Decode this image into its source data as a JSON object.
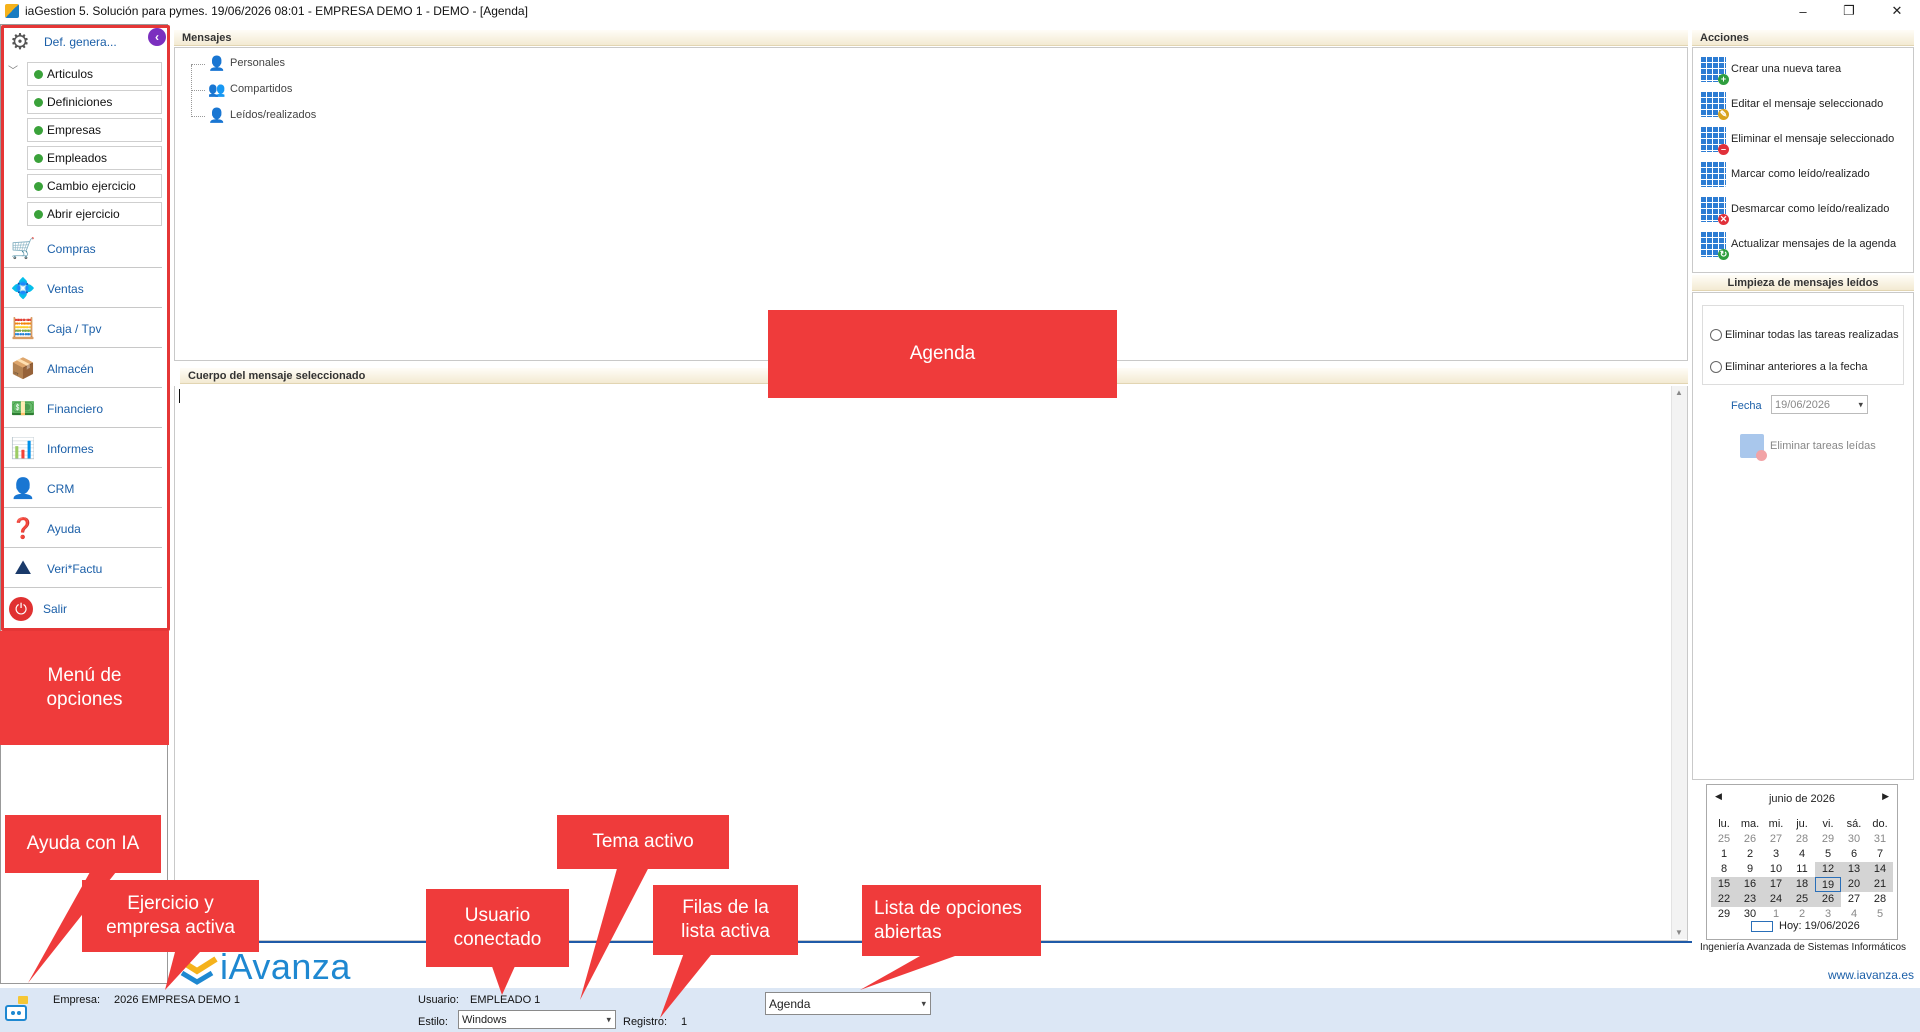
{
  "titlebar": {
    "title": "iaGestion 5. Solución para pymes.   19/06/2026 08:01   -   EMPRESA DEMO 1 - DEMO - [Agenda]",
    "minimize": "–",
    "maximize": "❐",
    "close": "✕"
  },
  "sidebar": {
    "header": "Def. genera...",
    "collapse_icon": "‹",
    "subitems": [
      "Articulos",
      "Definiciones",
      "Empresas",
      "Empleados",
      "Cambio ejercicio",
      "Abrir ejercicio"
    ],
    "items": [
      {
        "label": "Compras",
        "icon": "shopping-cart-icon",
        "glyph": "🛒"
      },
      {
        "label": "Ventas",
        "icon": "sales-icon",
        "glyph": "💠"
      },
      {
        "label": "Caja / Tpv",
        "icon": "cash-register-icon",
        "glyph": "🧮"
      },
      {
        "label": "Almacén",
        "icon": "warehouse-icon",
        "glyph": "📦"
      },
      {
        "label": "Financiero",
        "icon": "finance-icon",
        "glyph": "💵"
      },
      {
        "label": "Informes",
        "icon": "reports-icon",
        "glyph": "📊"
      },
      {
        "label": "CRM",
        "icon": "crm-icon",
        "glyph": "👤"
      },
      {
        "label": "Ayuda",
        "icon": "help-icon",
        "glyph": "❓"
      },
      {
        "label": "Veri*Factu",
        "icon": "verifactu-icon",
        "glyph": "⛰"
      },
      {
        "label": "Salir",
        "icon": "power-icon",
        "glyph": "⏻"
      }
    ]
  },
  "messages": {
    "header": "Mensajes",
    "tree": [
      "Personales",
      "Compartidos",
      "Leídos/realizados"
    ]
  },
  "body_panel": {
    "header": "Cuerpo del mensaje seleccionado"
  },
  "actions": {
    "header": "Acciones",
    "items": [
      {
        "label": "Crear una nueva tarea",
        "badge": "+",
        "badge_color": "#2e9e3e"
      },
      {
        "label": "Editar el mensaje seleccionado",
        "badge": "✎",
        "badge_color": "#d8a21d"
      },
      {
        "label": "Eliminar el mensaje seleccionado",
        "badge": "–",
        "badge_color": "#e0303a"
      },
      {
        "label": "Marcar como leído/realizado",
        "badge": "",
        "badge_color": "#2c7cd3"
      },
      {
        "label": "Desmarcar como leído/realizado",
        "badge": "✕",
        "badge_color": "#e0303a"
      },
      {
        "label": "Actualizar mensajes de la agenda",
        "badge": "↻",
        "badge_color": "#2e9e3e"
      }
    ]
  },
  "cleanup": {
    "header": "Limpieza de mensajes leídos",
    "option_all": "Eliminar todas las tareas realizadas",
    "option_before": "Eliminar anteriores a la fecha",
    "date_label": "Fecha",
    "date_value": "19/06/2026",
    "delete_button": "Eliminar tareas leídas"
  },
  "calendar": {
    "month": "junio de 2026",
    "weekdays": [
      "lu.",
      "ma.",
      "mi.",
      "ju.",
      "vi.",
      "sá.",
      "do."
    ],
    "weeks": [
      [
        "25",
        "26",
        "27",
        "28",
        "29",
        "30",
        "31"
      ],
      [
        "1",
        "2",
        "3",
        "4",
        "5",
        "6",
        "7"
      ],
      [
        "8",
        "9",
        "10",
        "11",
        "12",
        "13",
        "14"
      ],
      [
        "15",
        "16",
        "17",
        "18",
        "19",
        "20",
        "21"
      ],
      [
        "22",
        "23",
        "24",
        "25",
        "26",
        "27",
        "28"
      ],
      [
        "29",
        "30",
        "1",
        "2",
        "3",
        "4",
        "5"
      ]
    ],
    "today_label": "Hoy: 19/06/2026"
  },
  "brand": {
    "logo_text": "iAvanza",
    "company_line": "Ingeniería Avanzada de Sistemas Informáticos",
    "url": "www.iavanza.es"
  },
  "statusbar": {
    "empresa_label": "Empresa:",
    "empresa_value": "2026 EMPRESA DEMO 1",
    "usuario_label": "Usuario:",
    "usuario_value": "EMPLEADO 1",
    "estilo_label": "Estilo:",
    "estilo_value": "Windows",
    "registro_label": "Registro:",
    "registro_value": "1",
    "open_list_value": "Agenda"
  },
  "callouts": {
    "agenda": "Agenda",
    "menu": "Menú de opciones",
    "ia": "Ayuda con IA",
    "ejercicio": "Ejercicio y empresa activa",
    "usuario": "Usuario conectado",
    "tema": "Tema activo",
    "filas": "Filas de la lista activa",
    "lista": "Lista de opciones abiertas"
  }
}
